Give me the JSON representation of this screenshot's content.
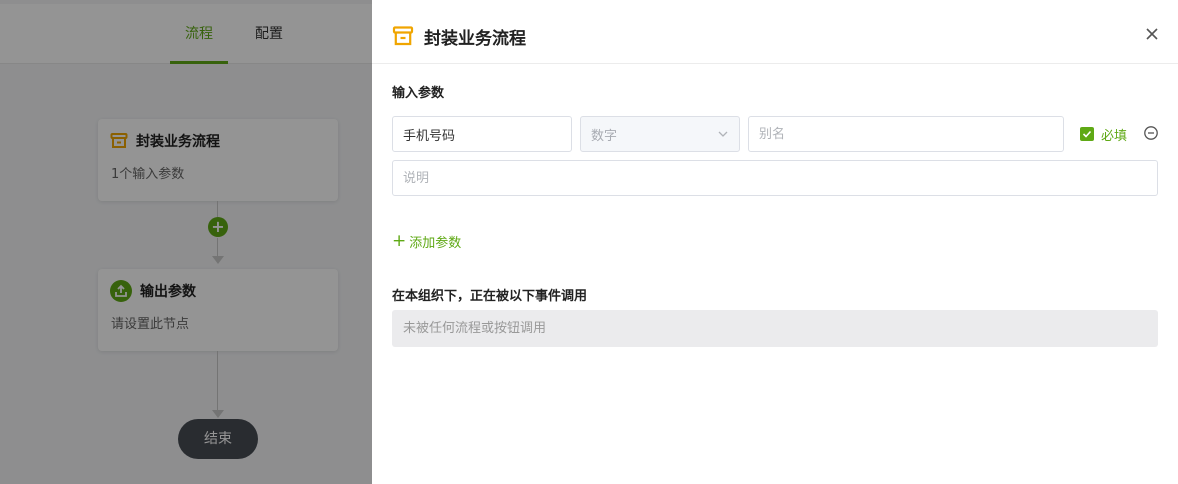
{
  "background": {
    "tabs": [
      {
        "label": "流程",
        "active": true
      },
      {
        "label": "配置",
        "active": false
      }
    ],
    "nodes": [
      {
        "title": "封装业务流程",
        "subtitle": "1个输入参数",
        "icon": "archive-icon"
      },
      {
        "title": "输出参数",
        "subtitle": "请设置此节点",
        "icon": "upload-icon"
      }
    ],
    "end_label": "结束"
  },
  "drawer": {
    "title": "封装业务流程",
    "title_icon": "archive-icon",
    "input_section_label": "输入参数",
    "params": [
      {
        "name_value": "手机号码",
        "type_value": "数字",
        "alias_placeholder": "别名",
        "required_label": "必填",
        "required_checked": true,
        "description_placeholder": "说明"
      }
    ],
    "add_param_label": "添加参数",
    "usage_section_label": "在本组织下，正在被以下事件调用",
    "usage_empty_text": "未被任何流程或按钮调用"
  },
  "colors": {
    "accent": "#5fa915",
    "title_icon": "#f0a500",
    "end_node": "#474c54"
  }
}
